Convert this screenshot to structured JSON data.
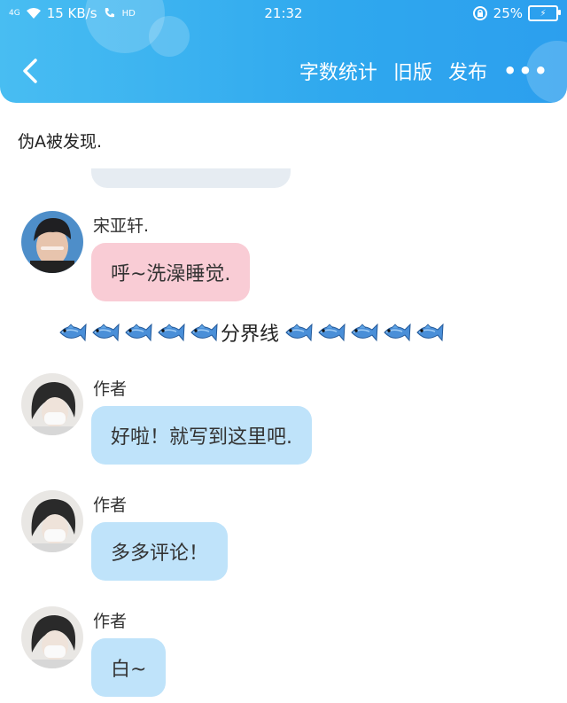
{
  "status_bar": {
    "network": "4G",
    "speed": "15 KB/s",
    "hd": "HD",
    "time": "21:32",
    "battery": "25%"
  },
  "nav": {
    "word_count": "字数统计",
    "old_version": "旧版",
    "publish": "发布",
    "more": "•••"
  },
  "content": {
    "chapter_title": "伪A被发现.",
    "messages": [
      {
        "name": "宋亚轩.",
        "text": "呼~洗澡睡觉.",
        "color": "#f9ccd5"
      },
      {
        "name": "作者",
        "text": "好啦！就写到这里吧.",
        "color": "#bfe3fa"
      },
      {
        "name": "作者",
        "text": "多多评论！",
        "color": "#bfe3fa"
      },
      {
        "name": "作者",
        "text": "白~",
        "color": "#bfe3fa"
      }
    ],
    "divider_label": "分界线",
    "divider_icon": "fish-icon"
  },
  "colors": {
    "header": "#2fa8ee",
    "pink_bubble": "#f9ccd5",
    "blue_bubble": "#bfe3fa"
  }
}
